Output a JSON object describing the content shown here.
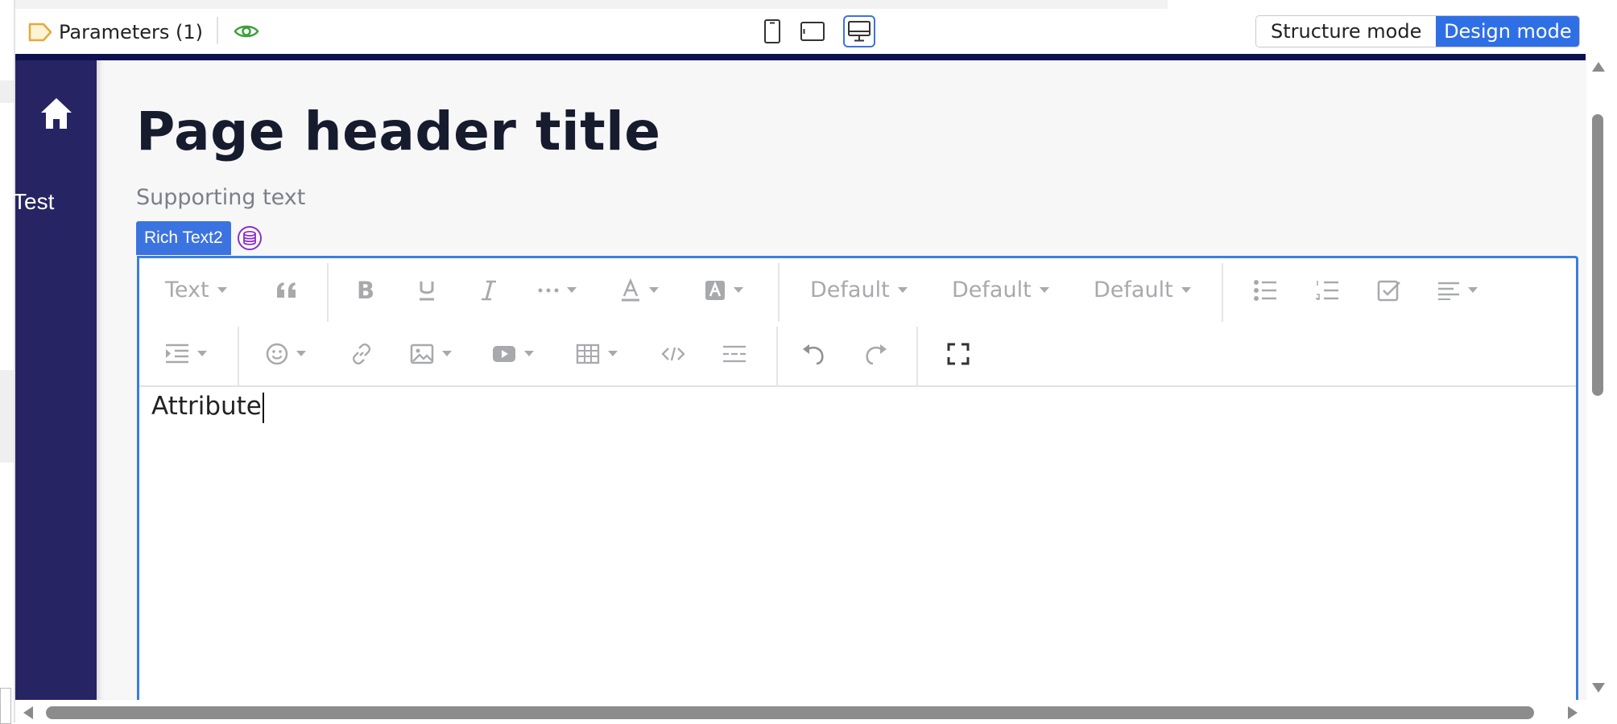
{
  "toolbar": {
    "parameters_label": "Parameters (1)",
    "structure_mode_label": "Structure mode",
    "design_mode_label": "Design mode",
    "active_device": "desktop",
    "active_mode": "design"
  },
  "sidebar": {
    "home_icon": "home-icon",
    "label": "Test"
  },
  "page": {
    "title": "Page header title",
    "supporting_text": "Supporting text"
  },
  "widget": {
    "label": "Rich Text2",
    "datasource_icon": "database-icon"
  },
  "editor": {
    "text_style": "Text",
    "font_family": "Default",
    "font_size": "Default",
    "line_height": "Default",
    "content": "Attribute"
  },
  "colors": {
    "accent": "#2f6fe6",
    "sidebar": "#272463",
    "navy_bar": "#0d1150",
    "parameters_tag": "#e6a93a",
    "preview_eye": "#3aa13a",
    "datasource": "#8b2fc9"
  }
}
